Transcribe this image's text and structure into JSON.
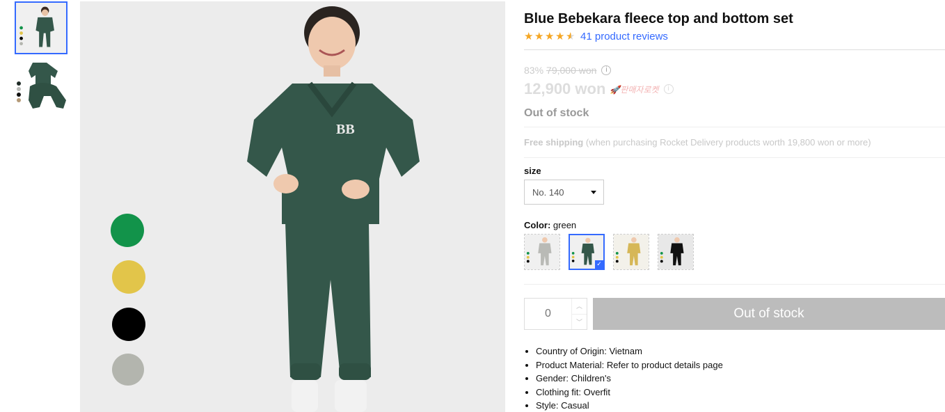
{
  "gallery": {
    "thumbnails": [
      {
        "label": "product-photo-child-green",
        "active": true
      },
      {
        "label": "product-photo-flatlay",
        "active": false
      }
    ],
    "main_color_dots": [
      "#12934a",
      "#e2c54a",
      "#000000",
      "#b3b5ae"
    ]
  },
  "product": {
    "title": "Blue Bebekara fleece top and bottom set",
    "rating": 4.5,
    "review_text": "41 product reviews",
    "discount_percent": "83%",
    "original_price": "79,000 won",
    "sale_price": "12,900 won",
    "rocket_badge": "판매자로켓",
    "stock_status": "Out of stock",
    "shipping_free": "Free shipping",
    "shipping_note": "(when purchasing Rocket Delivery products worth 19,800 won or more)"
  },
  "options": {
    "size_label": "size",
    "size_selected": "No. 140",
    "color_label": "Color:",
    "color_selected": "green",
    "color_swatches": [
      {
        "name": "gray",
        "color": "#b9bab6",
        "active": false
      },
      {
        "name": "green",
        "color": "#34574a",
        "active": true
      },
      {
        "name": "yellow",
        "color": "#d6b757",
        "active": false
      },
      {
        "name": "black",
        "color": "#111111",
        "active": false
      }
    ]
  },
  "purchase": {
    "quantity": "0",
    "button_label": "Out of stock"
  },
  "attributes": [
    "Country of Origin: Vietnam",
    "Product Material: Refer to product details page",
    "Gender: Children's",
    "Clothing fit: Overfit",
    "Style: Casual"
  ],
  "colors": {
    "accent": "#346aff",
    "star": "#f5a623",
    "disabled_button": "#bcbcbc"
  }
}
